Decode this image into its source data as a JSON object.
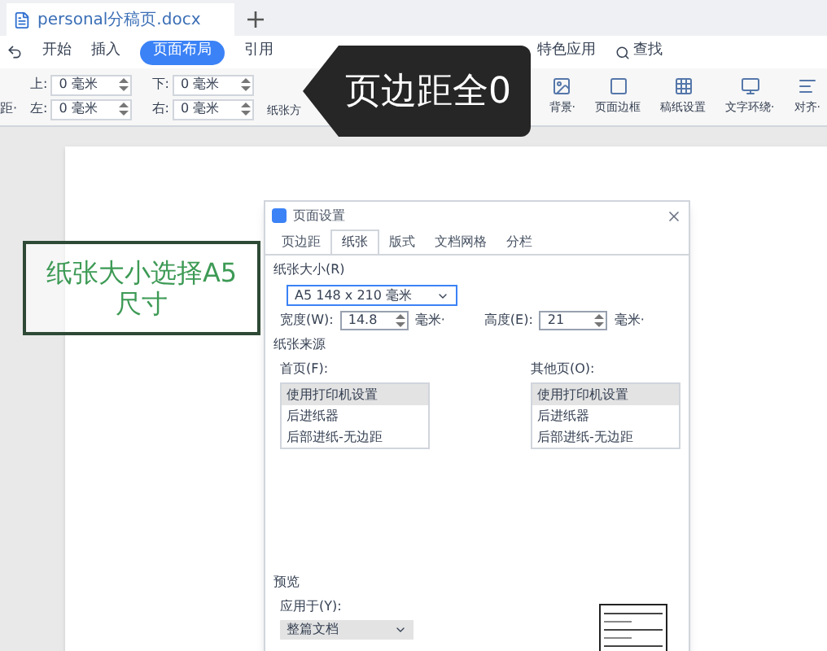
{
  "doc_tab": {
    "title": "personal分稿页.docx"
  },
  "menu": [
    {
      "label": "开始",
      "selected": false
    },
    {
      "label": "插入",
      "selected": false
    },
    {
      "label": "页面布局",
      "selected": true
    },
    {
      "label": "引用",
      "selected": false
    },
    {
      "label": "特色应用",
      "selected": false
    }
  ],
  "search": {
    "label": "查找"
  },
  "margins": [
    {
      "label": "上:",
      "value": "0 毫米"
    },
    {
      "label": "下:",
      "value": "0 毫米"
    },
    {
      "label": "左:",
      "value": "0 毫米"
    },
    {
      "label": "右:",
      "value": "0 毫米"
    }
  ],
  "toolbar_left": "距·",
  "toolbar_orientation": "纸张方",
  "toolbar": [
    {
      "label": "背景·"
    },
    {
      "label": "页面边框"
    },
    {
      "label": "稿纸设置"
    },
    {
      "label": "文字环绕·"
    },
    {
      "label": "对齐·"
    }
  ],
  "callout": {
    "text": "页边距全0"
  },
  "note": {
    "text": "纸张大小选择A5 尺寸"
  },
  "dialog": {
    "title": "页面设置",
    "tabs": [
      {
        "label": "页边距",
        "selected": false
      },
      {
        "label": "纸张",
        "selected": true
      },
      {
        "label": "版式",
        "selected": false
      },
      {
        "label": "文档网格",
        "selected": false
      },
      {
        "label": "分栏",
        "selected": false
      }
    ],
    "paper_size_group": "纸张大小(R)",
    "paper_size": "A5 148 x 210 毫米",
    "width": {
      "label": "宽度(W):",
      "value": "14.8",
      "unit": "毫米·"
    },
    "height": {
      "label": "高度(E):",
      "value": "21",
      "unit": "毫米·"
    },
    "source_group": "纸张来源",
    "sources": [
      {
        "label": "首页(F):",
        "items": [
          {
            "label": "使用打印机设置",
            "selected": true
          },
          {
            "label": "后进纸器",
            "selected": false
          },
          {
            "label": "后部进纸-无边距",
            "selected": false
          }
        ]
      },
      {
        "label": "其他页(O):",
        "items": [
          {
            "label": "使用打印机设置",
            "selected": true
          },
          {
            "label": "后进纸器",
            "selected": false
          },
          {
            "label": "后部进纸-无边距",
            "selected": false
          }
        ]
      }
    ],
    "preview_group": "预览",
    "apply_label": "应用于(Y):",
    "apply_value": "整篇文档"
  }
}
